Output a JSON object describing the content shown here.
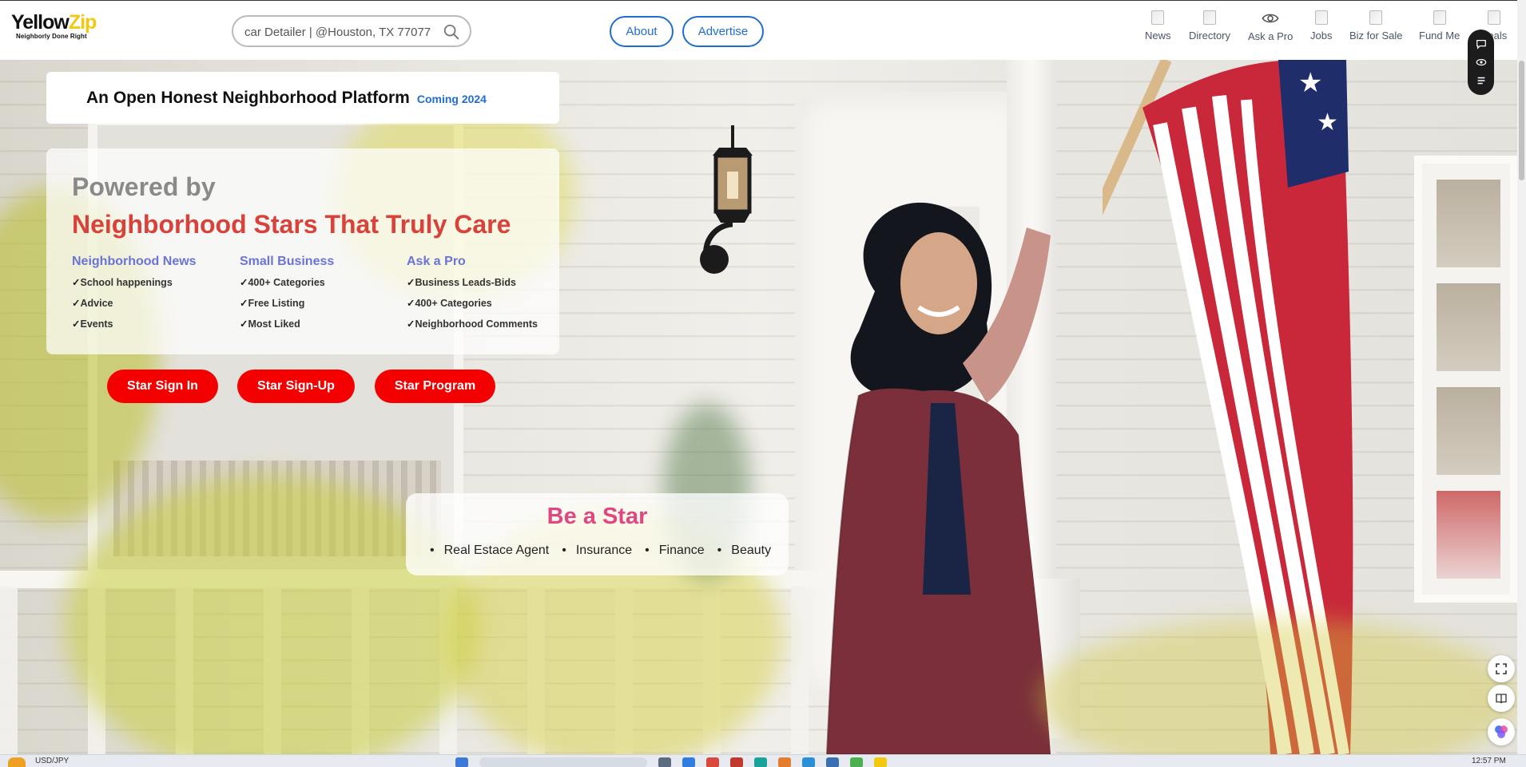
{
  "header": {
    "logo": {
      "word_a": "Yellow",
      "word_b": "Zip",
      "tagline": "Neighborly Done Right"
    },
    "search": {
      "value": "car Detailer | @Houston, TX 77077",
      "placeholder": ""
    },
    "about_label": "About",
    "advertise_label": "Advertise",
    "nav": [
      {
        "label": "News",
        "icon": "news-icon"
      },
      {
        "label": "Directory",
        "icon": "directory-icon"
      },
      {
        "label": "Ask a Pro",
        "icon": "eye-icon"
      },
      {
        "label": "Jobs",
        "icon": "jobs-icon"
      },
      {
        "label": "Biz for Sale",
        "icon": "biz-icon"
      },
      {
        "label": "Fund Me",
        "icon": "fund-icon"
      },
      {
        "label": "Deals",
        "icon": "deals-icon"
      }
    ]
  },
  "hero": {
    "platform_title": "An Open Honest Neighborhood Platform",
    "coming": "Coming 2024",
    "powered_by": "Powered by",
    "stars_line": "Neighborhood Stars That Truly Care",
    "columns": [
      {
        "heading": "Neighborhood News",
        "items": [
          "School happenings",
          "Advice",
          "Events"
        ]
      },
      {
        "heading": "Small Business",
        "items": [
          "400+ Categories",
          "Free Listing",
          "Most Liked"
        ]
      },
      {
        "heading": "Ask a Pro",
        "items": [
          "Business Leads-Bids",
          "400+ Categories",
          "Neighborhood Comments"
        ]
      }
    ],
    "buttons": {
      "sign_in": "Star Sign In",
      "sign_up": "Star Sign-Up",
      "program": "Star Program"
    },
    "be_a_star": {
      "title": "Be a Star",
      "items": [
        "Real Estace Agent",
        "Insurance",
        "Finance",
        "Beauty"
      ]
    }
  },
  "taskbar": {
    "ticker": "USD/JPY",
    "time": "12:57 PM"
  },
  "colors": {
    "accent_blue": "#1f6dd1",
    "cta_red": "#f40000",
    "heading_red": "#d9423a",
    "star_pink": "#e0467f",
    "column_heading": "#6b74d6",
    "logo_yellow": "#f2c811"
  }
}
